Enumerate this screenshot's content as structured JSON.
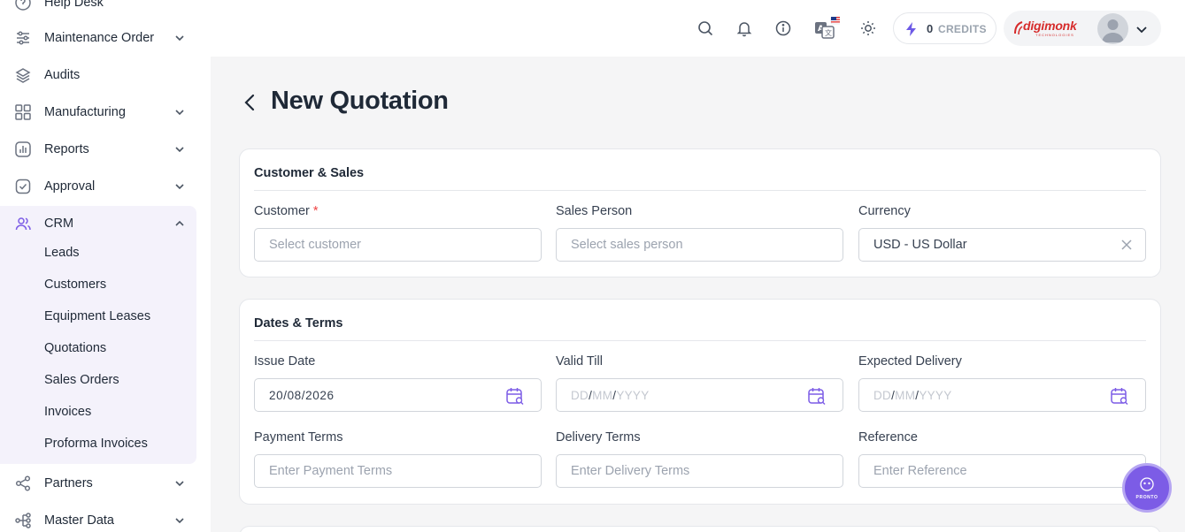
{
  "sidebar": {
    "items": [
      {
        "label": "Help Desk",
        "icon": "help-circle-icon"
      },
      {
        "label": "Maintenance Order",
        "icon": "sliders-icon"
      },
      {
        "label": "Audits",
        "icon": "layers-icon"
      },
      {
        "label": "Manufacturing",
        "icon": "grid-icon"
      },
      {
        "label": "Reports",
        "icon": "bar-chart-icon"
      },
      {
        "label": "Approval",
        "icon": "check-square-icon"
      },
      {
        "label": "CRM",
        "icon": "users-icon"
      },
      {
        "label": "Partners",
        "icon": "share-icon"
      },
      {
        "label": "Master Data",
        "icon": "hierarchy-icon"
      }
    ],
    "crm_sub": [
      "Leads",
      "Customers",
      "Equipment Leases",
      "Quotations",
      "Sales Orders",
      "Invoices",
      "Proforma Invoices"
    ]
  },
  "header": {
    "credits_count": "0",
    "credits_label": "CREDITS",
    "logo_text": "digimonk",
    "logo_sub": "TECHNOLOGIES",
    "icons": [
      "search-icon",
      "bell-icon",
      "info-icon",
      "translate-icon",
      "sun-icon"
    ]
  },
  "page": {
    "title": "New Quotation"
  },
  "customer_sales": {
    "title": "Customer & Sales",
    "customer_label": "Customer",
    "required_mark": "*",
    "customer_placeholder": "Select customer",
    "sales_person_label": "Sales Person",
    "sales_person_placeholder": "Select sales person",
    "currency_label": "Currency",
    "currency_value": "USD - US Dollar"
  },
  "dates_terms": {
    "title": "Dates & Terms",
    "issue_date_label": "Issue Date",
    "issue_date_value": "20/08/2026",
    "valid_till_label": "Valid Till",
    "expected_delivery_label": "Expected Delivery",
    "date_placeholder_dd": "DD",
    "date_placeholder_mm": "MM",
    "date_placeholder_yyyy": "YYYY",
    "payment_terms_label": "Payment Terms",
    "payment_terms_placeholder": "Enter Payment Terms",
    "delivery_terms_label": "Delivery Terms",
    "delivery_terms_placeholder": "Enter Delivery Terms",
    "reference_label": "Reference",
    "reference_placeholder": "Enter Reference"
  },
  "assistant": {
    "label": "PRONTO"
  },
  "colors": {
    "accent": "#7c5ce6",
    "required": "#ef4444",
    "credits_bolt": "#6d5ae6",
    "logo_red": "#d62b2b"
  }
}
